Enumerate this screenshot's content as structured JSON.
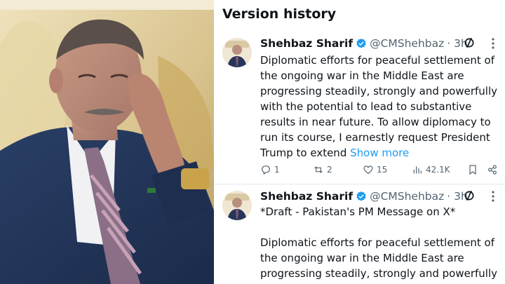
{
  "panel": {
    "title": "Version history"
  },
  "tweets": [
    {
      "name": "Shehbaz Sharif",
      "handle": "@CMShehbaz",
      "time": "· 3h",
      "lines": [
        "Diplomatic efforts for peaceful settlement of",
        "the ongoing war in the Middle East are",
        "progressing steadily, strongly and powerfully",
        "with the potential to lead to substantive",
        "results in near future. To allow diplomacy to",
        "run its course, I earnestly request President"
      ],
      "last_line": "Trump to extend ",
      "show_more": "Show more",
      "stats": {
        "replies": "1",
        "reposts": "2",
        "likes": "15",
        "views": "42.1K"
      }
    },
    {
      "name": "Shehbaz Sharif",
      "handle": "@CMShehbaz",
      "time": "· 3h",
      "draft": "*Draft - Pakistan's PM Message on X*",
      "lines": [
        "Diplomatic efforts for peaceful settlement of",
        "the ongoing war in the Middle East are",
        "progressing steadily, strongly and powerfully"
      ]
    }
  ],
  "colors": {
    "accent": "#1d9bf0",
    "text": "#0f1419",
    "muted": "#536471"
  },
  "icons": [
    "verified-badge-icon",
    "edit-history-icon",
    "more-icon",
    "reply-icon",
    "repost-icon",
    "like-icon",
    "views-icon",
    "bookmark-icon",
    "share-icon"
  ]
}
